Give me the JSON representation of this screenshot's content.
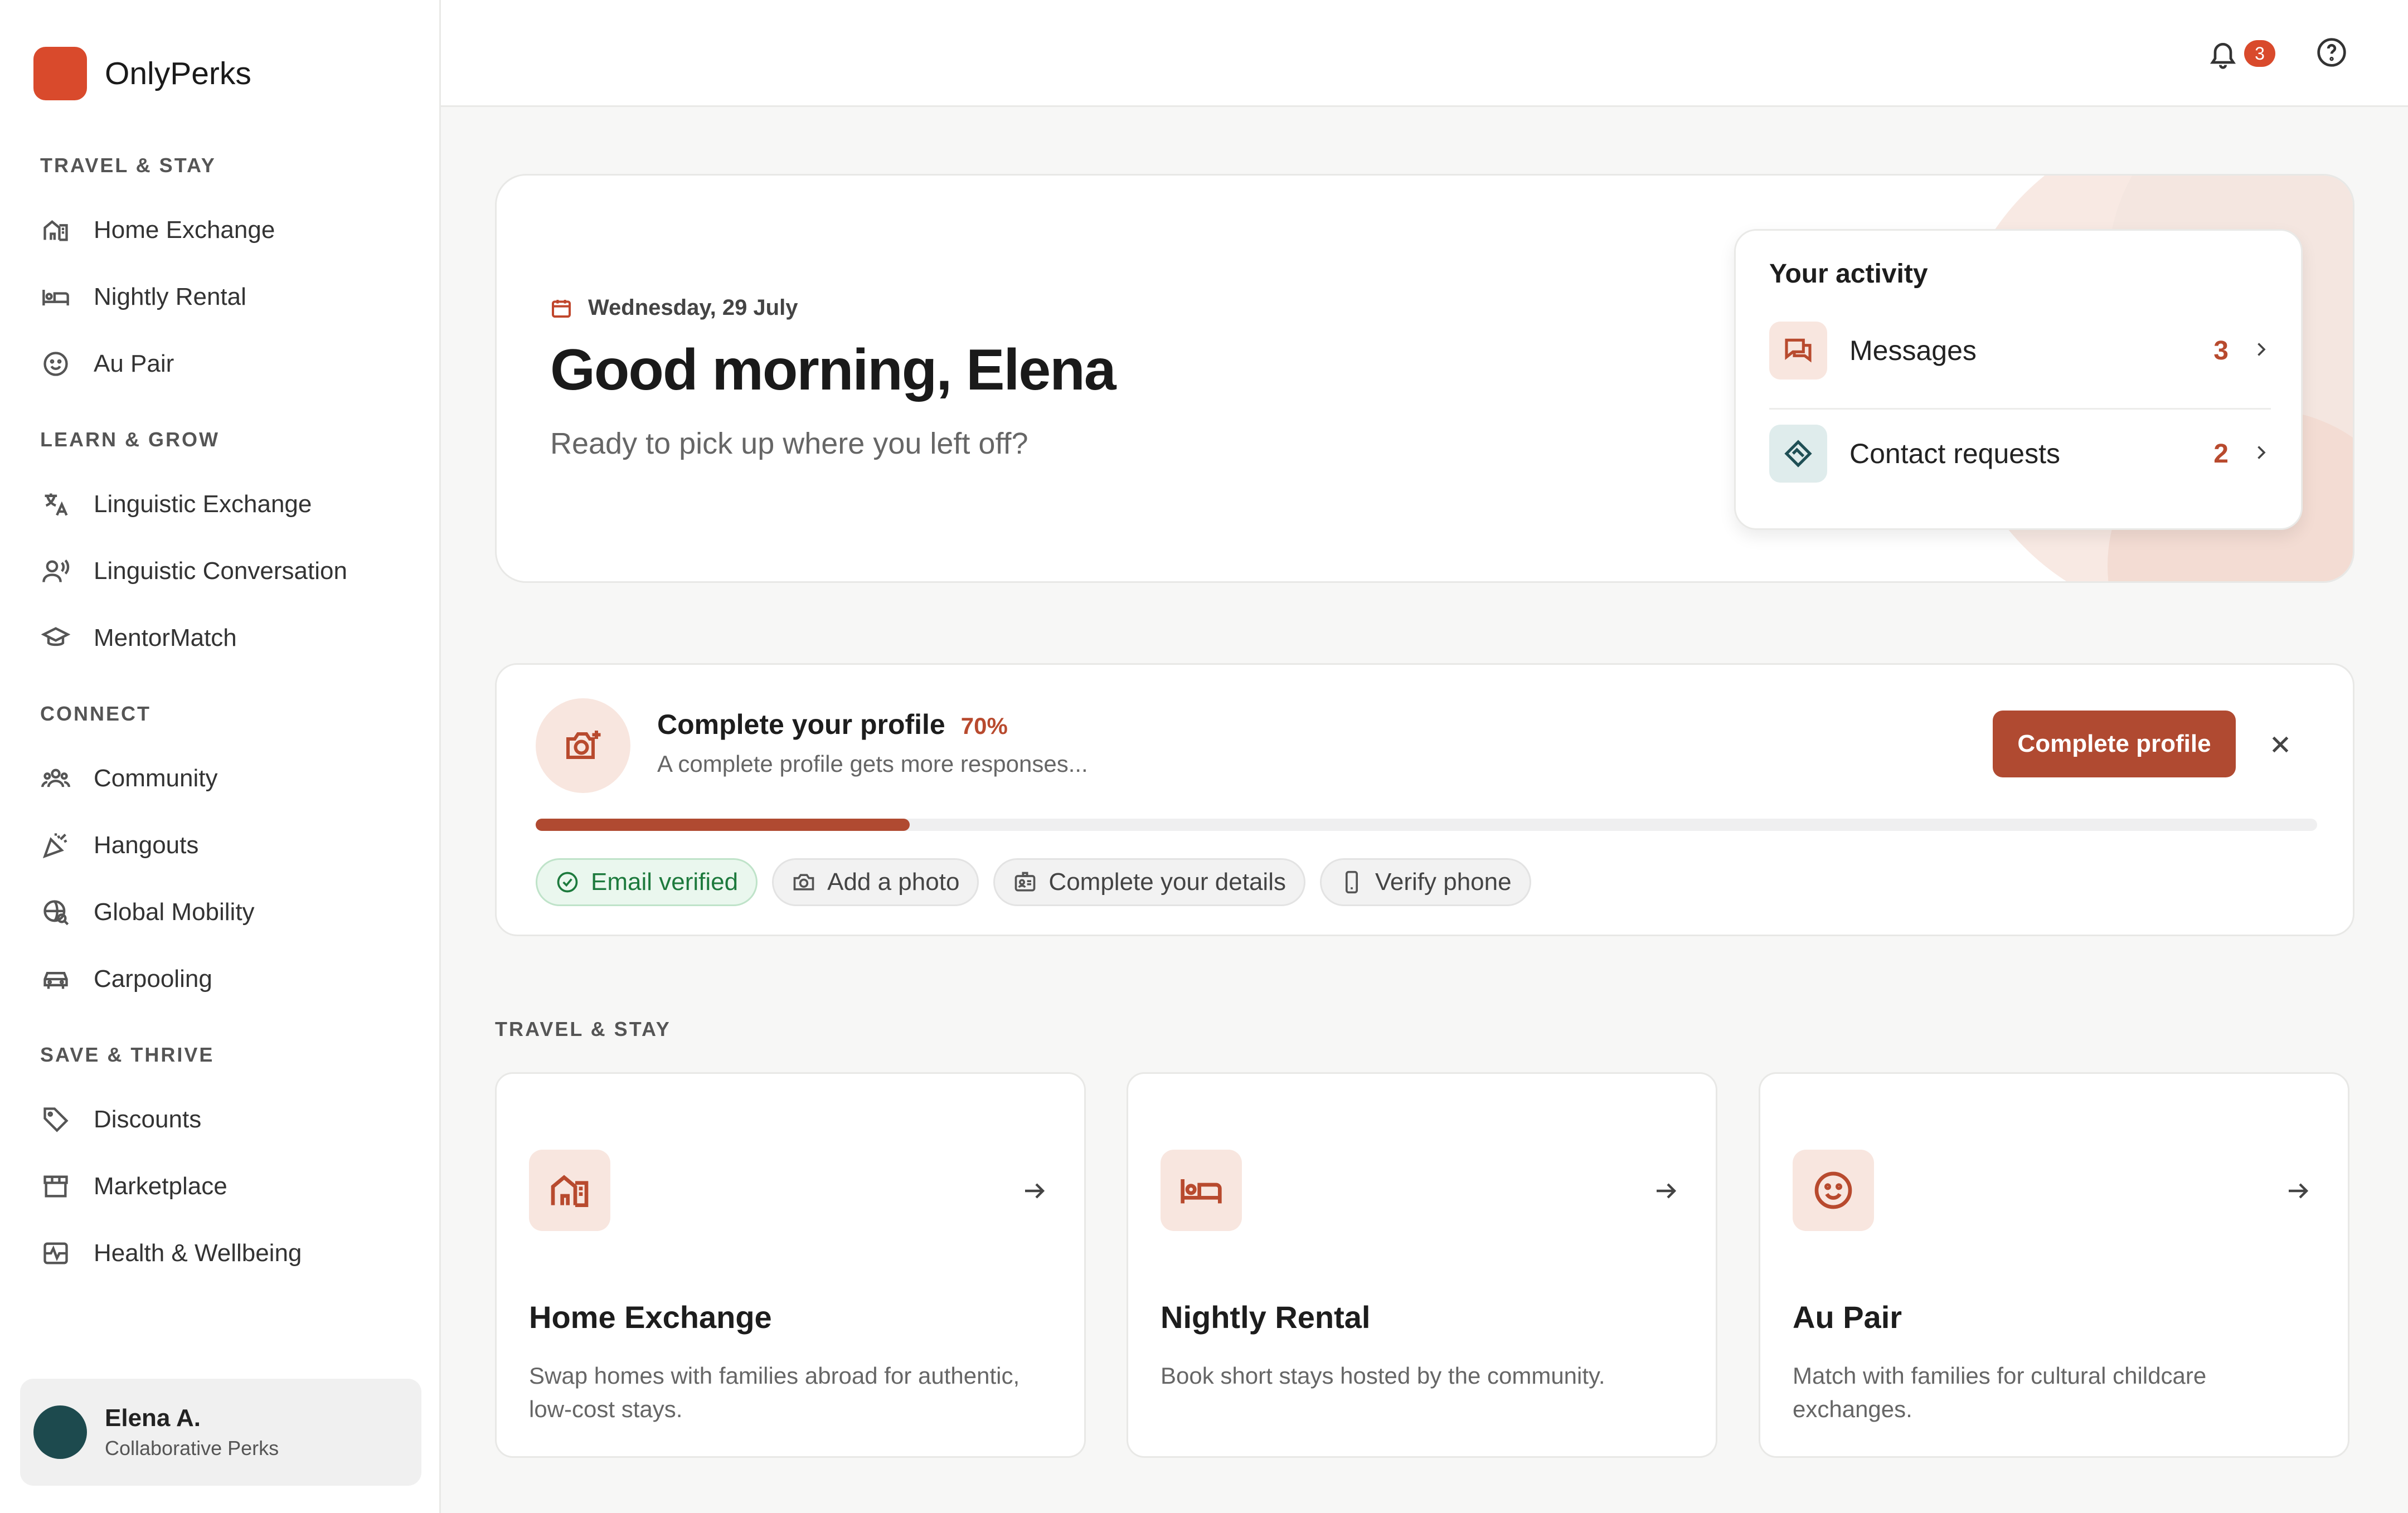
{
  "brand": {
    "name": "OnlyPerks",
    "color": "#d94a2c"
  },
  "sidebar": {
    "sections": [
      {
        "title": "TRAVEL & STAY",
        "items": [
          {
            "label": "Home Exchange",
            "icon": "home-exchange-icon"
          },
          {
            "label": "Nightly Rental",
            "icon": "bed-icon"
          },
          {
            "label": "Au Pair",
            "icon": "smiley-icon"
          }
        ]
      },
      {
        "title": "LEARN & GROW",
        "items": [
          {
            "label": "Linguistic Exchange",
            "icon": "translate-icon"
          },
          {
            "label": "Linguistic Conversation",
            "icon": "speaking-user-icon"
          },
          {
            "label": "MentorMatch",
            "icon": "graduation-cap-icon"
          }
        ]
      },
      {
        "title": "CONNECT",
        "items": [
          {
            "label": "Community",
            "icon": "people-icon"
          },
          {
            "label": "Hangouts",
            "icon": "party-popper-icon"
          },
          {
            "label": "Global Mobility",
            "icon": "globe-search-icon"
          },
          {
            "label": "Carpooling",
            "icon": "car-icon"
          }
        ]
      },
      {
        "title": "SAVE & THRIVE",
        "items": [
          {
            "label": "Discounts",
            "icon": "tag-icon"
          },
          {
            "label": "Marketplace",
            "icon": "store-icon"
          },
          {
            "label": "Health & Wellbeing",
            "icon": "heart-pulse-icon"
          }
        ]
      }
    ]
  },
  "user": {
    "name": "Elena A.",
    "subtitle": "Collaborative Perks"
  },
  "topbar": {
    "notification_count": "3"
  },
  "hero": {
    "date": "Wednesday, 29 July",
    "greeting": "Good morning, Elena",
    "subtitle": "Ready to pick up where you left off?"
  },
  "activity": {
    "title": "Your activity",
    "rows": [
      {
        "label": "Messages",
        "count": "3"
      },
      {
        "label": "Contact requests",
        "count": "2"
      }
    ]
  },
  "profile": {
    "title": "Complete your profile",
    "percent": "70%",
    "progress": 0.21,
    "subtitle": "A complete profile gets more responses...",
    "button": "Complete profile",
    "chips": [
      {
        "label": "Email verified",
        "done": true
      },
      {
        "label": "Add a photo",
        "done": false
      },
      {
        "label": "Complete your details",
        "done": false
      },
      {
        "label": "Verify phone",
        "done": false
      }
    ]
  },
  "section": {
    "title": "TRAVEL & STAY",
    "cards": [
      {
        "title": "Home Exchange",
        "desc": "Swap homes with families abroad for authentic, low-cost stays."
      },
      {
        "title": "Nightly Rental",
        "desc": "Book short stays hosted by the community."
      },
      {
        "title": "Au Pair",
        "desc": "Match with families for cultural childcare exchanges."
      }
    ]
  }
}
